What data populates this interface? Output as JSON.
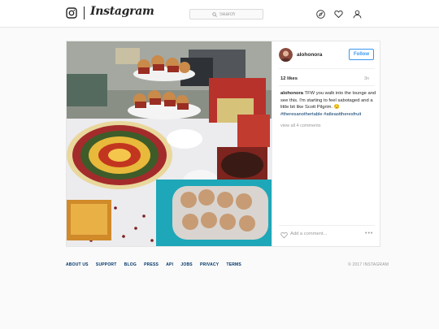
{
  "header": {
    "wordmark": "Instagram",
    "search": {
      "placeholder": "Search"
    },
    "nav_icons": [
      "compass-icon",
      "heart-icon",
      "profile-icon"
    ]
  },
  "post": {
    "username": "alohonora",
    "follow_label": "Follow",
    "likes": "12 likes",
    "time": "3n",
    "caption": {
      "username": "alohonora",
      "text": "TFW you walk into the lounge and see this. I'm starting to feel sabotaged and a little bit like Scott Pilgrim. 😒",
      "hashtags": "#theresanothertable #atleasttheresfruit"
    },
    "view_all_comments": "view all 4 comments",
    "add_comment_placeholder": "Add a comment..."
  },
  "footer": {
    "links": [
      "ABOUT US",
      "SUPPORT",
      "BLOG",
      "PRESS",
      "API",
      "JOBS",
      "PRIVACY",
      "TERMS"
    ],
    "copyright": "© 2017 INSTAGRAM"
  },
  "colors": {
    "accent_blue": "#3897f0",
    "link_blue": "#003569",
    "border": "#e6e6e6",
    "background": "#fafafa"
  }
}
